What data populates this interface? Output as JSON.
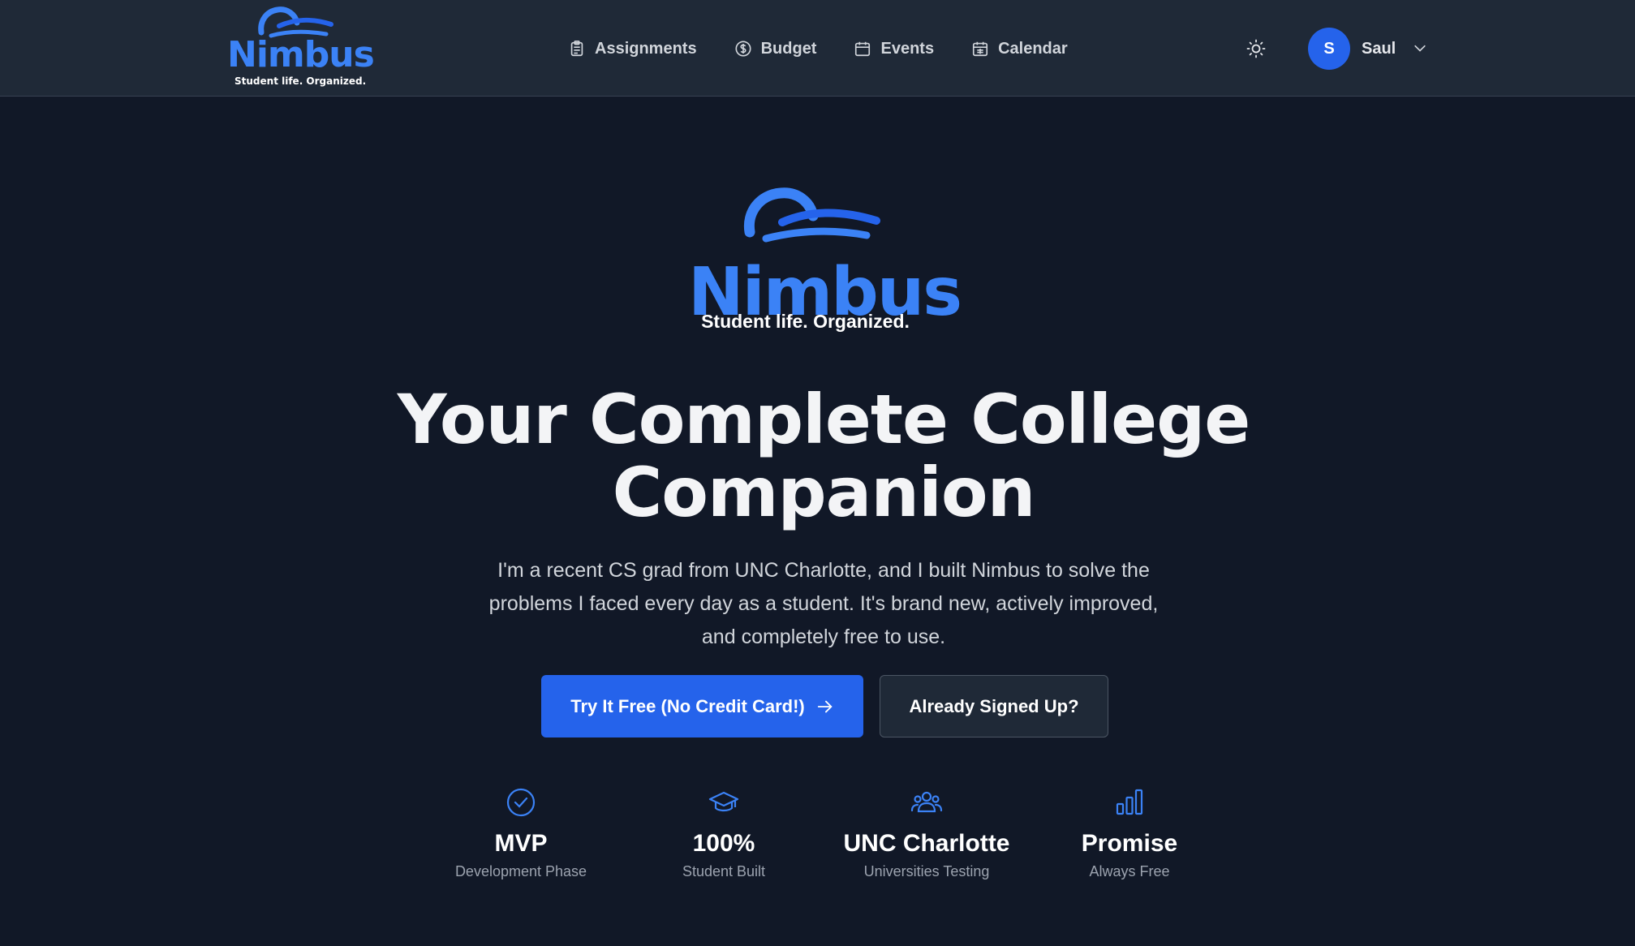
{
  "brand": {
    "name": "Nimbus",
    "tagline": "Student life. Organized.",
    "color": "#3b82f6"
  },
  "nav": {
    "links": [
      {
        "label": "Assignments",
        "icon": "clipboard-icon"
      },
      {
        "label": "Budget",
        "icon": "dollar-icon"
      },
      {
        "label": "Events",
        "icon": "calendar-icon"
      },
      {
        "label": "Calendar",
        "icon": "calendar-grid-icon"
      }
    ],
    "theme_toggle_icon": "sun-icon",
    "user": {
      "initial": "S",
      "name": "Saul",
      "avatar_color": "#2563eb"
    }
  },
  "hero": {
    "title_line1": "Your Complete College",
    "title_line2": "Companion",
    "description": "I'm a recent CS grad from UNC Charlotte, and I built Nimbus to solve the problems I faced every day as a student. It's brand new, actively improved, and completely free to use.",
    "primary_button": "Try It Free (No Credit Card!)",
    "secondary_button": "Already Signed Up?"
  },
  "stats": [
    {
      "icon": "check-circle-icon",
      "value": "MVP",
      "label": "Development Phase"
    },
    {
      "icon": "graduation-cap-icon",
      "value": "100%",
      "label": "Student Built"
    },
    {
      "icon": "users-icon",
      "value": "UNC Charlotte",
      "label": "Universities Testing"
    },
    {
      "icon": "bar-chart-icon",
      "value": "Promise",
      "label": "Always Free"
    }
  ],
  "colors": {
    "background": "#111827",
    "navbar": "#1f2937",
    "accent": "#2563eb",
    "icon_blue": "#3b82f6"
  }
}
